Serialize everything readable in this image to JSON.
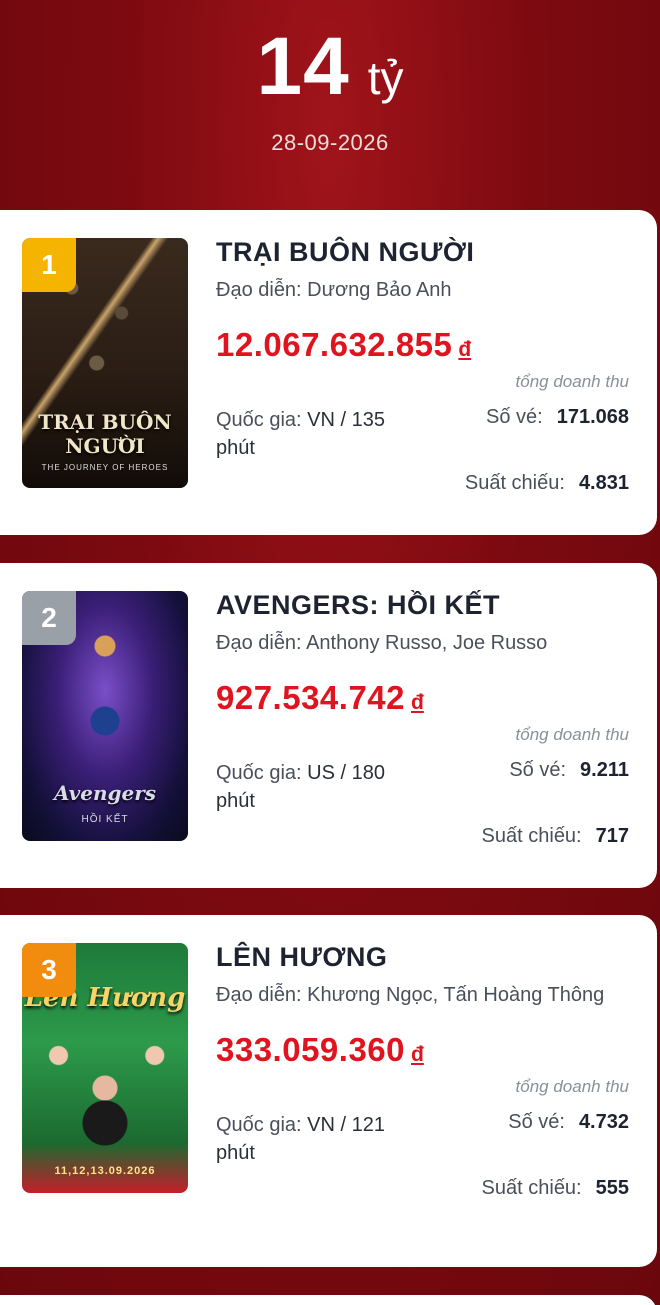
{
  "header": {
    "total_value": "14",
    "total_unit": "tỷ",
    "date": "28-09-2026"
  },
  "colors": {
    "gold": "#f4b400",
    "silver": "#9aa0a8",
    "bronze": "#f28c0f",
    "revenue": "#e0141e"
  },
  "movies": [
    {
      "rank": "1",
      "title": "TRẠI BUÔN NGƯỜI",
      "director": "Đạo diễn: Dương Bảo Anh",
      "revenue": "12.067.632.855",
      "currency": "đ",
      "revenue_label": "tổng doanh thu",
      "country_label": "Quốc gia:",
      "country_value": "VN / 135 phút",
      "tickets_label": "Số vé:",
      "tickets": "171.068",
      "shows_label": "Suất chiếu:",
      "shows": "4.831",
      "poster_title": "TRẠI BUÔN NGƯỜI",
      "poster_subtitle": "THE JOURNEY OF HEROES"
    },
    {
      "rank": "2",
      "title": "AVENGERS: HỒI KẾT",
      "director": "Đạo diễn: Anthony Russo, Joe Russo",
      "revenue": "927.534.742",
      "currency": "đ",
      "revenue_label": "tổng doanh thu",
      "country_label": "Quốc gia:",
      "country_value": "US / 180 phút",
      "tickets_label": "Số vé:",
      "tickets": "9.211",
      "shows_label": "Suất chiếu:",
      "shows": "717",
      "poster_title": "Avengers",
      "poster_subtitle": "HỒI KẾT"
    },
    {
      "rank": "3",
      "title": "LÊN HƯƠNG",
      "director": "Đạo diễn: Khương Ngọc, Tấn Hoàng Thông",
      "revenue": "333.059.360",
      "currency": "đ",
      "revenue_label": "tổng doanh thu",
      "country_label": "Quốc gia:",
      "country_value": "VN / 121 phút",
      "tickets_label": "Số vé:",
      "tickets": "4.732",
      "shows_label": "Suất chiếu:",
      "shows": "555",
      "poster_title": "Lên Hương",
      "poster_subtitle": "11,12,13.09.2026"
    }
  ]
}
